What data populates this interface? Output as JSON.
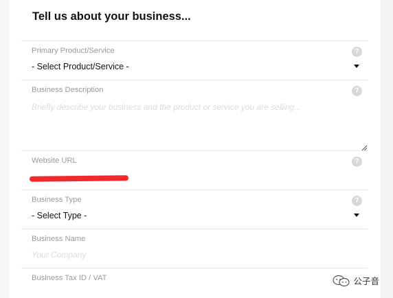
{
  "form": {
    "title": "Tell us about your business...",
    "help_glyph": "?",
    "fields": [
      {
        "label": "Primary Product/Service",
        "value": "- Select Product/Service -"
      },
      {
        "label": "Business Description",
        "placeholder": "Briefly describe your business and the product or service you are selling..."
      },
      {
        "label": "Website URL",
        "value": ""
      },
      {
        "label": "Business Type",
        "value": "- Select Type -"
      },
      {
        "label": "Business Name",
        "placeholder": "Your Company"
      },
      {
        "label": "Business Tax ID / VAT"
      }
    ]
  },
  "watermark": {
    "text": "公子音"
  },
  "icons": {
    "help": "question-circle-icon",
    "dropdown": "caret-down-icon",
    "resize": "resize-grip-icon",
    "watermark": "wechat-logo-icon"
  },
  "colors": {
    "label": "#9a9a9a",
    "help_bg": "#d8d8d8",
    "redaction": "#ee2a2a",
    "divider": "#e6e6e6"
  }
}
